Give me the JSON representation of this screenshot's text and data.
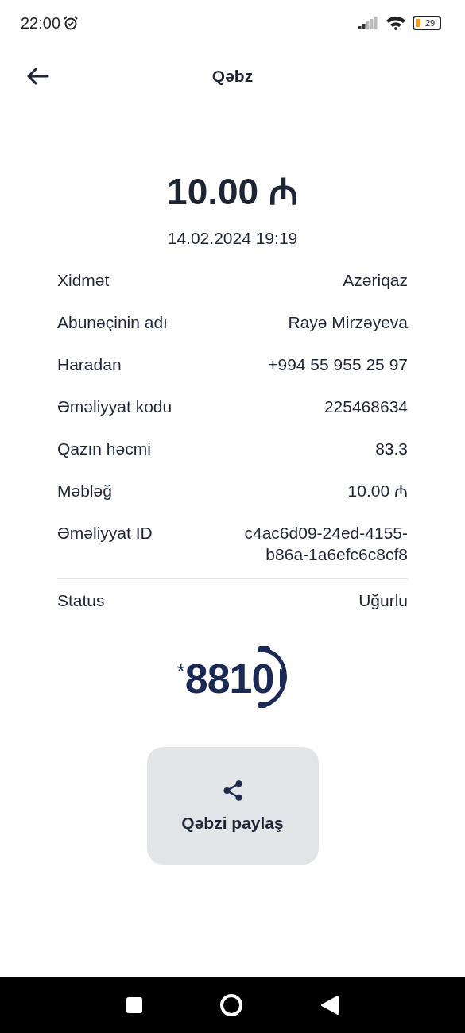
{
  "status_bar": {
    "time": "22:00",
    "battery": "29"
  },
  "header": {
    "title": "Qəbz"
  },
  "amount": "10.00 ₼",
  "date": "14.02.2024 19:19",
  "details": [
    {
      "label": "Xidmət",
      "value": "Azəriqaz"
    },
    {
      "label": "Abunəçinin adı",
      "value": "Rayə Mirzəyeva"
    },
    {
      "label": "Haradan",
      "value": "+994 55 955 25 97"
    },
    {
      "label": "Əməliyyat kodu",
      "value": "225468634"
    },
    {
      "label": "Qazın həcmi",
      "value": "83.3"
    },
    {
      "label": "Məbləğ",
      "value": "10.00 ₼"
    },
    {
      "label": "Əməliyyat ID",
      "value": "c4ac6d09-24ed-4155-b86a-1a6efc6c8cf8"
    }
  ],
  "status": {
    "label": "Status",
    "value": "Uğurlu"
  },
  "logo": {
    "star": "*",
    "number": "8810"
  },
  "share_button": {
    "label": "Qəbzi paylaş"
  }
}
